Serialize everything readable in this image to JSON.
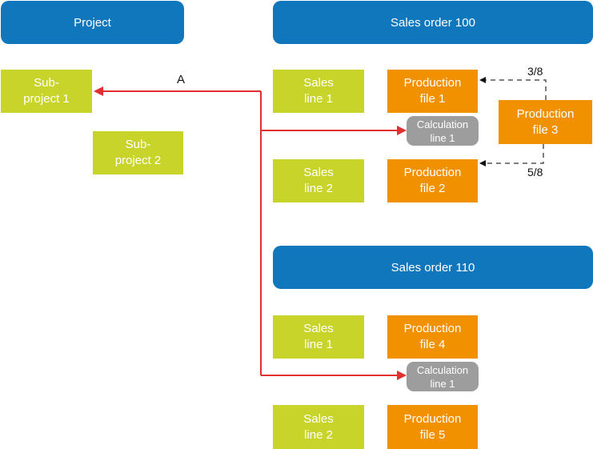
{
  "headers": {
    "project": "Project",
    "sales_order_100": "Sales order 100",
    "sales_order_110": "Sales order 110"
  },
  "subprojects": [
    "Sub-\nproject 1",
    "Sub-\nproject 2"
  ],
  "order_100": {
    "sales_lines": [
      "Sales\nline 1",
      "Sales\nline 2"
    ],
    "production_files": [
      "Production\nfile 1",
      "Production\nfile 2",
      "Production\nfile 3"
    ],
    "calculation_line": "Calculation\nline 1"
  },
  "order_110": {
    "sales_lines": [
      "Sales\nline 1",
      "Sales\nline 2"
    ],
    "production_files": [
      "Production\nfile 4",
      "Production\nfile 5"
    ],
    "calculation_line": "Calculation\nline 1"
  },
  "edge_labels": {
    "a": "A",
    "split_top": "3/8",
    "split_bottom": "5/8"
  },
  "colors": {
    "header": "#1077bc",
    "subproject_sales": "#c9d42a",
    "production": "#f29100",
    "calculation": "#9d9d9d",
    "link_red": "#e03030",
    "link_dashed": "#555555"
  }
}
